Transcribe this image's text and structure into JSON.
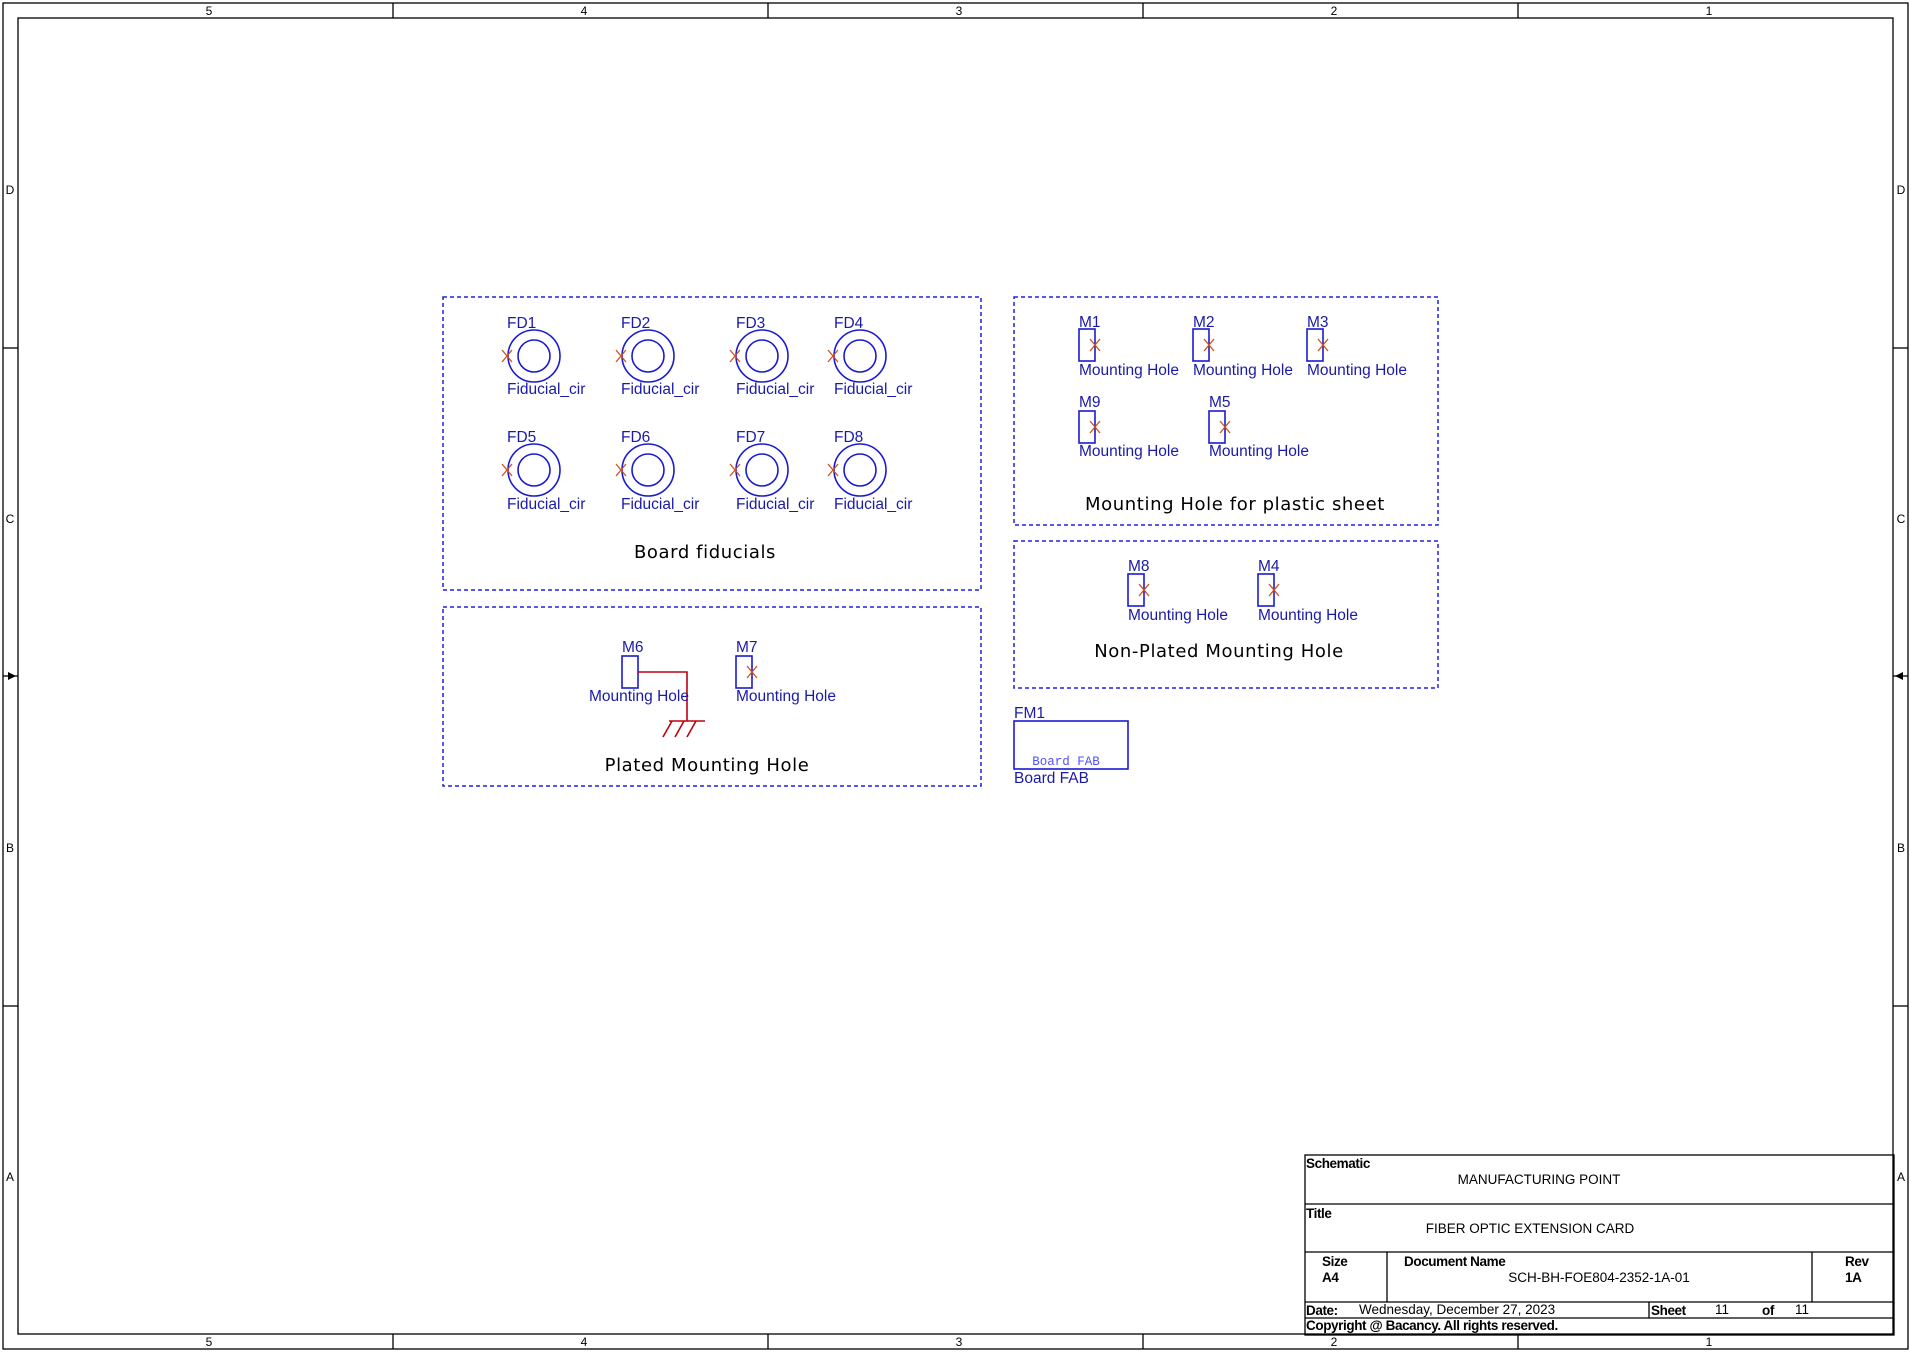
{
  "colors": {
    "component": "#1a1ad0",
    "label": "#1a1aa8",
    "group_border": "#2020e0",
    "pin_mark": "#d0501a",
    "wire": "#c00010",
    "fab_text": "#5050ff",
    "frame": "#000000"
  },
  "frame": {
    "columns": [
      "5",
      "4",
      "3",
      "2",
      "1"
    ],
    "rows": [
      "D",
      "C",
      "B",
      "A"
    ]
  },
  "groups": {
    "board_fiducials": {
      "title": "Board fiducials",
      "parts": [
        {
          "ref": "FD1",
          "value": "Fiducial_cir"
        },
        {
          "ref": "FD2",
          "value": "Fiducial_cir"
        },
        {
          "ref": "FD3",
          "value": "Fiducial_cir"
        },
        {
          "ref": "FD4",
          "value": "Fiducial_cir"
        },
        {
          "ref": "FD5",
          "value": "Fiducial_cir"
        },
        {
          "ref": "FD6",
          "value": "Fiducial_cir"
        },
        {
          "ref": "FD7",
          "value": "Fiducial_cir"
        },
        {
          "ref": "FD8",
          "value": "Fiducial_cir"
        }
      ]
    },
    "plated_mounting_hole": {
      "title": "Plated Mounting Hole",
      "parts": [
        {
          "ref": "M6",
          "value": "Mounting Hole"
        },
        {
          "ref": "M7",
          "value": "Mounting Hole"
        }
      ]
    },
    "plastic_sheet": {
      "title": "Mounting Hole for plastic sheet",
      "parts": [
        {
          "ref": "M1",
          "value": "Mounting Hole"
        },
        {
          "ref": "M2",
          "value": "Mounting Hole"
        },
        {
          "ref": "M3",
          "value": "Mounting Hole"
        },
        {
          "ref": "M9",
          "value": "Mounting Hole"
        },
        {
          "ref": "M5",
          "value": "Mounting Hole"
        }
      ]
    },
    "non_plated": {
      "title": "Non-Plated Mounting Hole",
      "parts": [
        {
          "ref": "M8",
          "value": "Mounting Hole"
        },
        {
          "ref": "M4",
          "value": "Mounting Hole"
        }
      ]
    }
  },
  "fab": {
    "ref": "FM1",
    "inner_text": "Board FAB",
    "value": "Board FAB"
  },
  "title_block": {
    "schematic_label": "Schematic",
    "schematic_value": "MANUFACTURING POINT",
    "title_label": "Title",
    "title_value": "FIBER OPTIC EXTENSION CARD",
    "size_label": "Size",
    "size_value": "A4",
    "docname_label": "Document Name",
    "docname_value": "SCH-BH-FOE804-2352-1A-01",
    "rev_label": "Rev",
    "rev_value": "1A",
    "date_label": "Date:",
    "date_value": "Wednesday, December 27, 2023",
    "sheet_label": "Sheet",
    "sheet_value": "11",
    "of_label": "of",
    "of_value": "11",
    "copyright": "Copyright @ Bacancy. All rights reserved."
  }
}
